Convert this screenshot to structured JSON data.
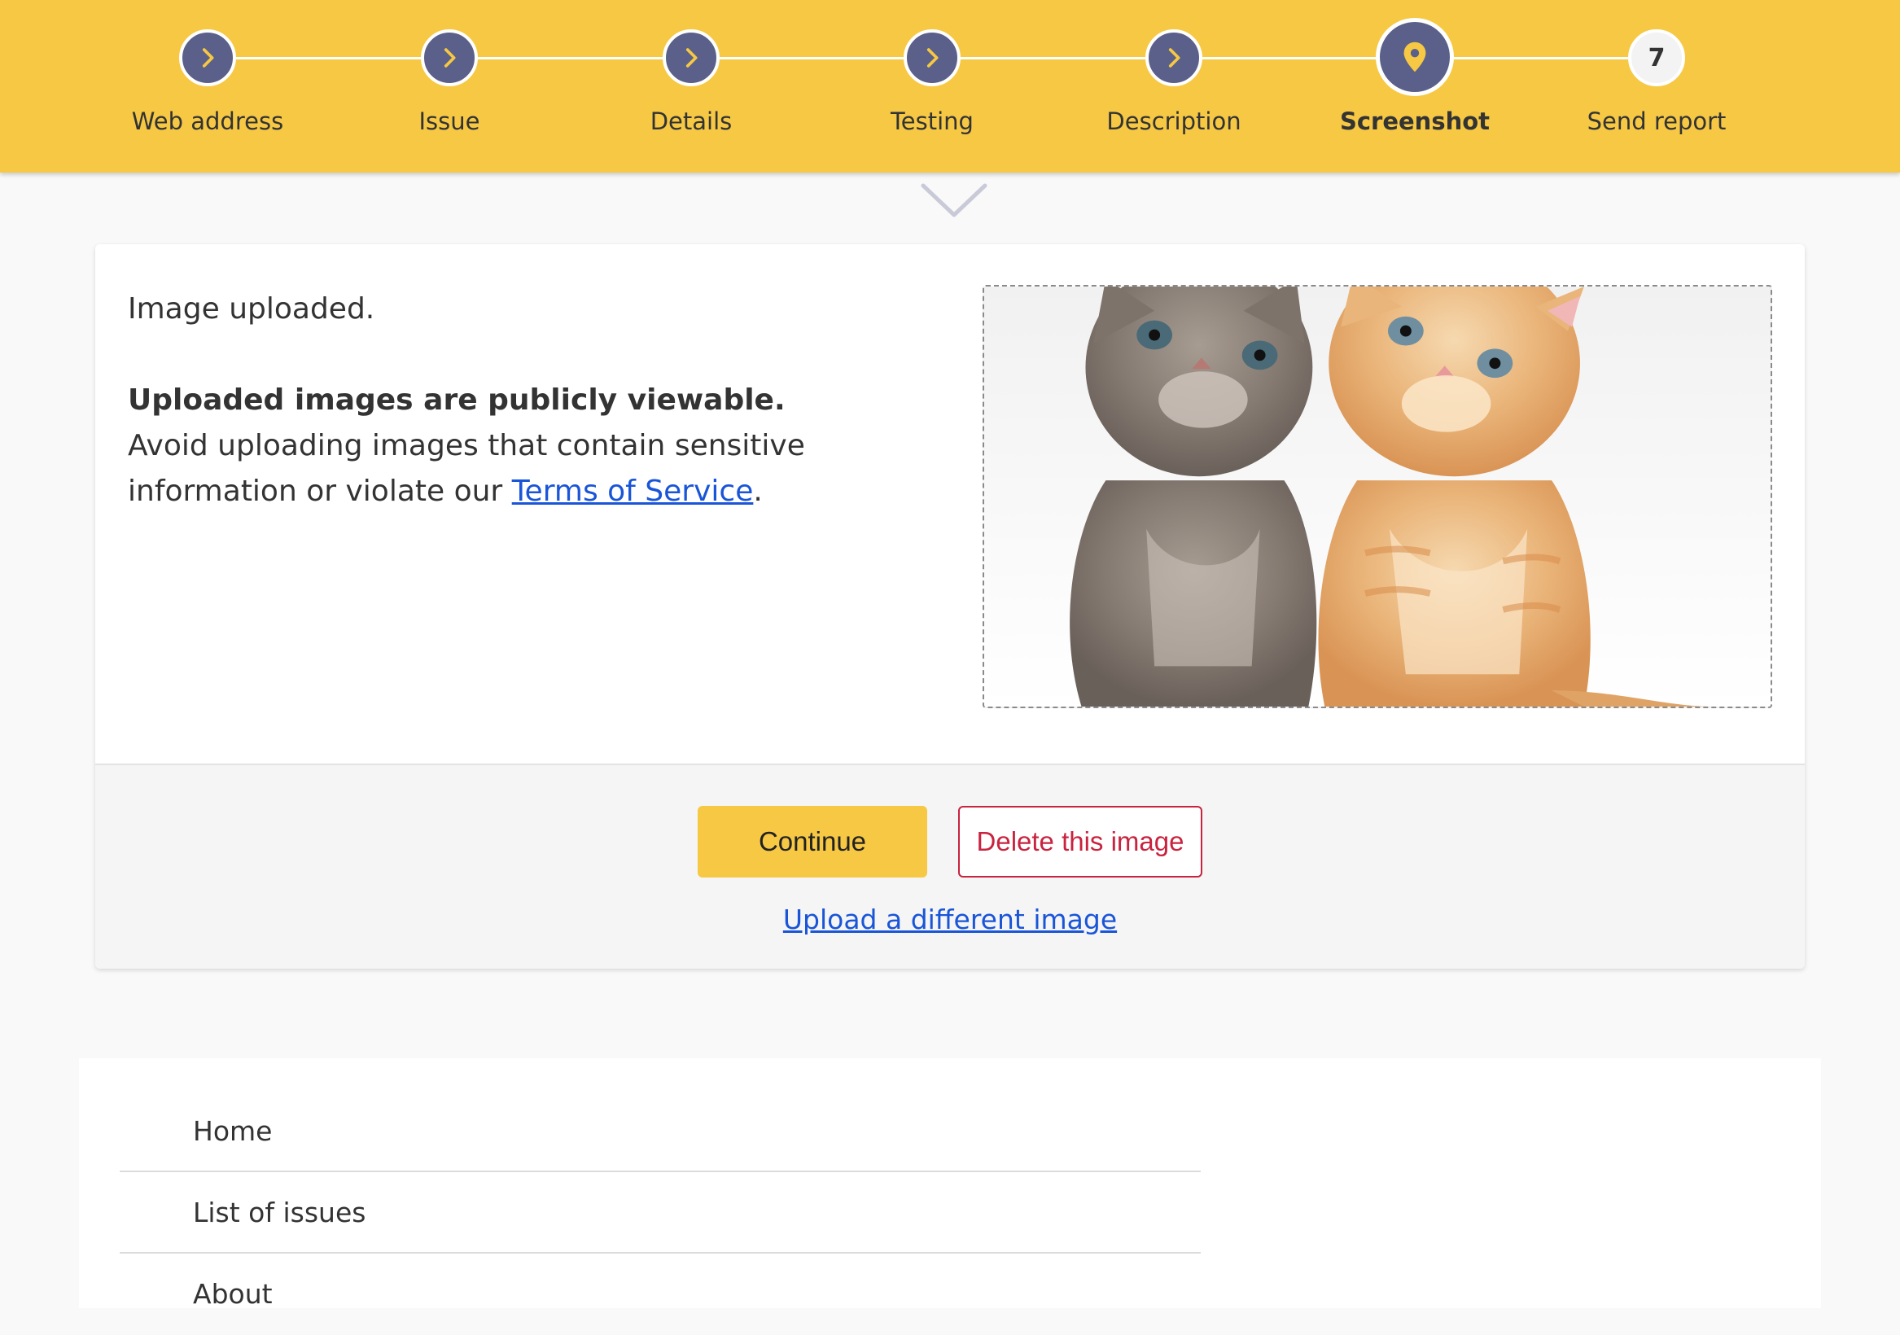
{
  "stepper": {
    "steps": [
      {
        "label": "Web address",
        "state": "done",
        "icon": "chevron-right-icon"
      },
      {
        "label": "Issue",
        "state": "done",
        "icon": "chevron-right-icon"
      },
      {
        "label": "Details",
        "state": "done",
        "icon": "chevron-right-icon"
      },
      {
        "label": "Testing",
        "state": "done",
        "icon": "chevron-right-icon"
      },
      {
        "label": "Description",
        "state": "done",
        "icon": "chevron-right-icon"
      },
      {
        "label": "Screenshot",
        "state": "current",
        "icon": "location-pin-icon"
      },
      {
        "label": "Send report",
        "state": "future",
        "number": "7"
      }
    ]
  },
  "card": {
    "status": "Image uploaded.",
    "warning_title": "Uploaded images are publicly viewable.",
    "warning_text_before": "Avoid uploading images that contain sensitive information or violate our ",
    "terms_link": "Terms of Service",
    "warning_text_after": ".",
    "image_icon": "kittens-image",
    "continue_label": "Continue",
    "delete_label": "Delete this image",
    "upload_link": "Upload a different image"
  },
  "footer_nav": {
    "items": [
      "Home",
      "List of issues",
      "About"
    ]
  },
  "colors": {
    "header_bg": "#f6c844",
    "step_done": "#5a6089",
    "link": "#1a55d8",
    "danger": "#c8233f"
  }
}
